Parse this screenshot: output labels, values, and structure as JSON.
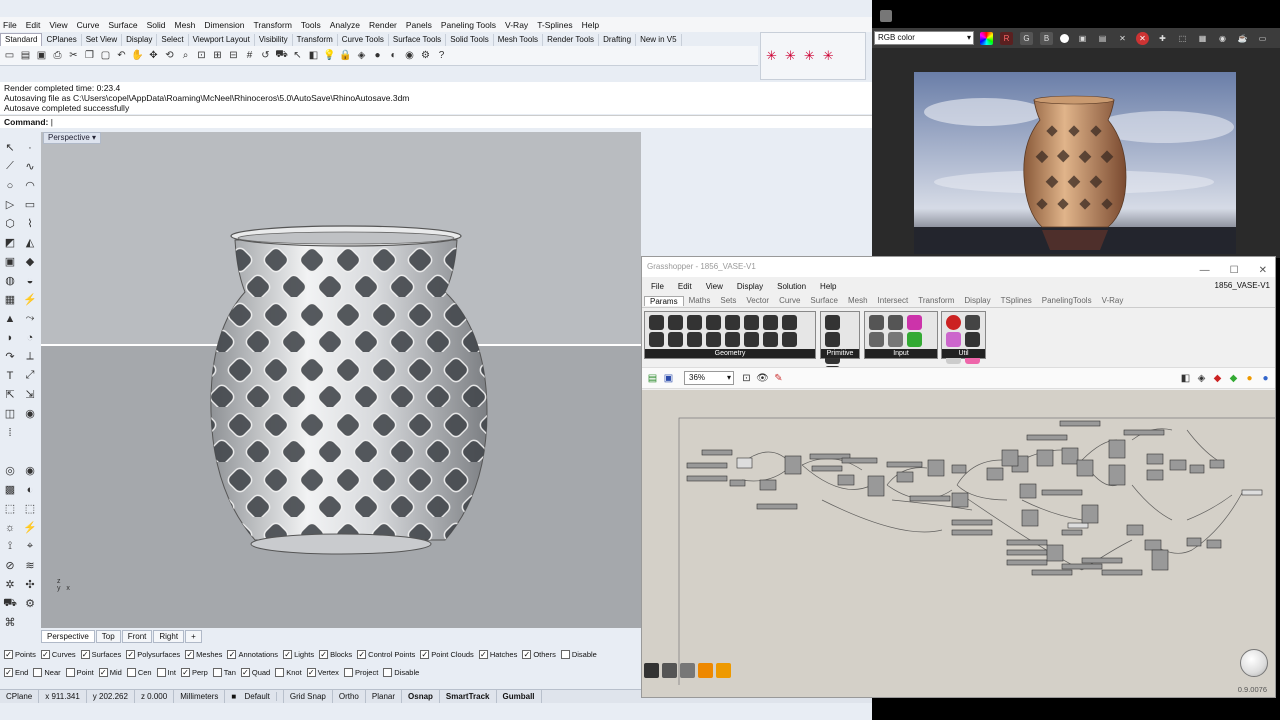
{
  "menu": [
    "File",
    "Edit",
    "View",
    "Curve",
    "Surface",
    "Solid",
    "Mesh",
    "Dimension",
    "Transform",
    "Tools",
    "Analyze",
    "Render",
    "Panels",
    "Paneling Tools",
    "V-Ray",
    "T-Splines",
    "Help"
  ],
  "toolbar_tabs": [
    "Standard",
    "CPlanes",
    "Set View",
    "Display",
    "Select",
    "Viewport Layout",
    "Visibility",
    "Transform",
    "Curve Tools",
    "Surface Tools",
    "Solid Tools",
    "Mesh Tools",
    "Render Tools",
    "Drafting",
    "New in V5"
  ],
  "history": [
    "Render completed time: 0:23.4",
    "Autosaving file as C:\\Users\\copel\\AppData\\Roaming\\McNeel\\Rhinoceros\\5.0\\AutoSave\\RhinoAutosave.3dm",
    "Autosave completed successfully"
  ],
  "command_label": "Command:",
  "viewport": {
    "title": "Perspective",
    "axes": "z\ny  x"
  },
  "view_tabs": [
    "Perspective",
    "Top",
    "Front",
    "Right"
  ],
  "filters_row1": [
    {
      "label": "Points",
      "checked": true
    },
    {
      "label": "Curves",
      "checked": true
    },
    {
      "label": "Surfaces",
      "checked": true
    },
    {
      "label": "Polysurfaces",
      "checked": true
    },
    {
      "label": "Meshes",
      "checked": true
    },
    {
      "label": "Annotations",
      "checked": true
    },
    {
      "label": "Lights",
      "checked": true
    },
    {
      "label": "Blocks",
      "checked": true
    },
    {
      "label": "Control Points",
      "checked": true
    },
    {
      "label": "Point Clouds",
      "checked": true
    },
    {
      "label": "Hatches",
      "checked": true
    },
    {
      "label": "Others",
      "checked": true
    },
    {
      "label": "Disable",
      "checked": false
    }
  ],
  "filters_row2": [
    {
      "label": "End",
      "checked": true
    },
    {
      "label": "Near",
      "checked": false
    },
    {
      "label": "Point",
      "checked": false
    },
    {
      "label": "Mid",
      "checked": true
    },
    {
      "label": "Cen",
      "checked": false
    },
    {
      "label": "Int",
      "checked": false
    },
    {
      "label": "Perp",
      "checked": true
    },
    {
      "label": "Tan",
      "checked": false
    },
    {
      "label": "Quad",
      "checked": true
    },
    {
      "label": "Knot",
      "checked": false
    },
    {
      "label": "Vertex",
      "checked": true
    },
    {
      "label": "Project",
      "checked": false
    },
    {
      "label": "Disable",
      "checked": false
    }
  ],
  "status": {
    "cplane": "CPlane",
    "x": "x 911.341",
    "y": "y 202.262",
    "z": "z 0.000",
    "units": "Millimeters",
    "layer": "Default",
    "grid_snap": "Grid Snap",
    "ortho": "Ortho",
    "planar": "Planar",
    "osnap": "Osnap",
    "smarttrack": "SmartTrack",
    "gumball": "Gumball"
  },
  "vray": {
    "color_channel": "RGB color",
    "channels": [
      "R",
      "G",
      "B"
    ]
  },
  "grasshopper": {
    "title": "Grasshopper - 1856_VASE-V1",
    "doc_name": "1856_VASE-V1",
    "menu": [
      "File",
      "Edit",
      "View",
      "Display",
      "Solution",
      "Help"
    ],
    "tabs": [
      "Params",
      "Maths",
      "Sets",
      "Vector",
      "Curve",
      "Surface",
      "Mesh",
      "Intersect",
      "Transform",
      "Display",
      "TSplines",
      "PanelingTools",
      "V-Ray"
    ],
    "ribbon_groups": [
      "Geometry",
      "Primitive",
      "Input",
      "Util"
    ],
    "zoom": "36%",
    "version": "0.9.0076"
  }
}
